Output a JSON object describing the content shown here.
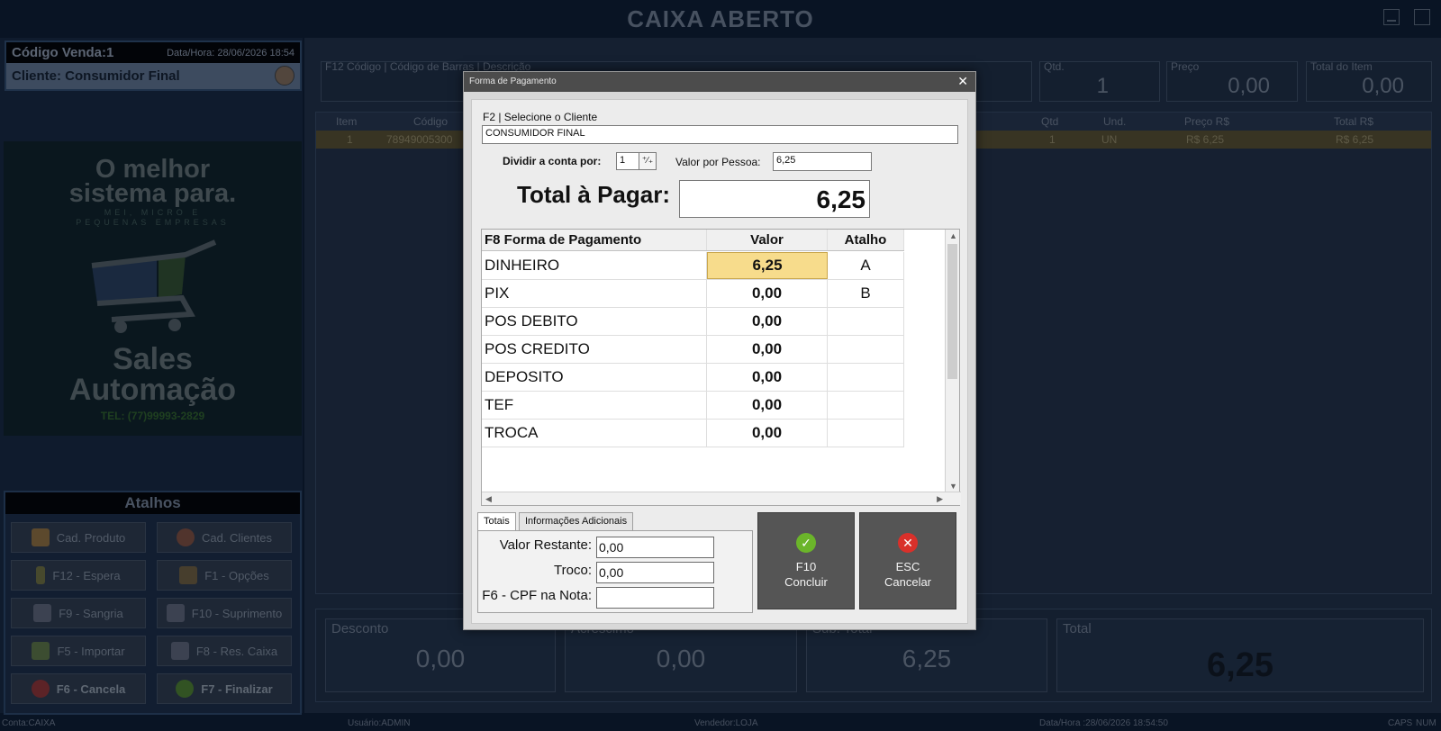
{
  "app": {
    "title": "CAIXA ABERTO",
    "sale": {
      "code": "Código Venda:1",
      "datetime": "Data/Hora: 28/06/2026 18:54",
      "client": "Cliente: Consumidor Final"
    },
    "banner": {
      "line1": "O melhor",
      "line2": "sistema para.",
      "line3": "MEI, MICRO E",
      "line4": "PEQUENAS EMPRESAS",
      "line5": "Sales",
      "line6": "Automação",
      "phone": "TEL: (77)99993-2829"
    },
    "atalhos": {
      "title": "Atalhos",
      "items": [
        {
          "label": "Cad. Produto",
          "icon": "box-icon"
        },
        {
          "label": "Cad. Clientes",
          "icon": "user-icon"
        },
        {
          "label": "F12 - Espera",
          "icon": "hourglass-icon"
        },
        {
          "label": "F1 - Opções",
          "icon": "options-icon"
        },
        {
          "label": "F9 - Sangria",
          "icon": "document-out-icon"
        },
        {
          "label": "F10 - Suprimento",
          "icon": "document-in-icon"
        },
        {
          "label": "F5 - Importar",
          "icon": "download-icon"
        },
        {
          "label": "F8 - Res. Caixa",
          "icon": "clipboard-icon"
        },
        {
          "label": "F6 - Cancela",
          "icon": "cancel-icon"
        },
        {
          "label": "F7 - Finalizar",
          "icon": "check-icon"
        }
      ]
    },
    "fields": {
      "search_label": "F12  Código | Código de Barras | Descrição",
      "qtd_label": "Qtd.",
      "qtd_value": "1",
      "preco_label": "Preço",
      "preco_value": "0,00",
      "total_item_label": "Total do Item",
      "total_item_value": "0,00"
    },
    "grid": {
      "headers": [
        "Item",
        "Código",
        "Qtd",
        "Und.",
        "Preço R$",
        "Total R$"
      ],
      "row": {
        "item": "1",
        "codigo": "78949005300",
        "qtd": "1",
        "und": "UN",
        "preco": "R$ 6,25",
        "total": "R$ 6,25"
      }
    },
    "totals": {
      "desconto_label": "Desconto",
      "desconto": "0,00",
      "acrescimo_label": "Acréscimo",
      "acrescimo": "0,00",
      "subtotal_label": "Sub. Total",
      "subtotal": "6,25",
      "total_label": "Total",
      "total": "6,25"
    },
    "status": {
      "conta": "Conta:CAIXA",
      "usuario": "Usuário:ADMIN",
      "vendedor": "Vendedor:LOJA",
      "datahora": "Data/Hora :28/06/2026 18:54:50",
      "caps": "CAPS",
      "num": "NUM"
    }
  },
  "dialog": {
    "title": "Forma de Pagamento",
    "close": "✕",
    "client_label": "F2 | Selecione o Cliente",
    "client_value": "CONSUMIDOR FINAL",
    "split_label": "Dividir a conta por:",
    "split_value": "1",
    "per_person_label": "Valor por Pessoa:",
    "per_person_value": "6,25",
    "total_label": "Total à Pagar:",
    "total_value": "6,25",
    "table": {
      "headers": {
        "name": "F8 Forma de Pagamento",
        "value": "Valor",
        "key": "Atalho"
      },
      "rows": [
        {
          "name": "DINHEIRO",
          "value": "6,25",
          "key": "A",
          "selected": true
        },
        {
          "name": "PIX",
          "value": "0,00",
          "key": "B"
        },
        {
          "name": "POS DEBITO",
          "value": "0,00",
          "key": ""
        },
        {
          "name": "POS CREDITO",
          "value": "0,00",
          "key": ""
        },
        {
          "name": "DEPOSITO",
          "value": "0,00",
          "key": ""
        },
        {
          "name": "TEF",
          "value": "0,00",
          "key": ""
        },
        {
          "name": "TROCA",
          "value": "0,00",
          "key": ""
        }
      ]
    },
    "tabs": [
      "Totais",
      "Informações Adicionais"
    ],
    "valor_restante_label": "Valor Restante:",
    "valor_restante": "0,00",
    "troco_label": "Troco:",
    "troco": "0,00",
    "cpf_label": "F6 - CPF na Nota:",
    "cpf": "",
    "btn_concluir": {
      "key": "F10",
      "label": "Concluir",
      "icon": "check-circle-icon",
      "color": "#6bb52a"
    },
    "btn_cancelar": {
      "key": "ESC",
      "label": "Cancelar",
      "icon": "x-circle-icon",
      "color": "#d9302a"
    }
  }
}
